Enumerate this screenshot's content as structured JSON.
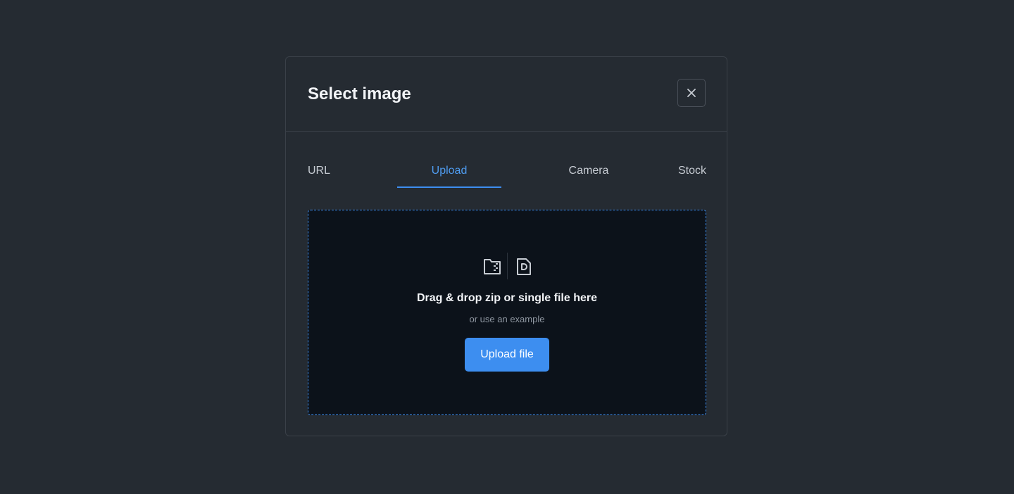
{
  "modal": {
    "title": "Select image",
    "close_icon": "close-icon"
  },
  "tabs": [
    {
      "label": "URL",
      "active": false
    },
    {
      "label": "Upload",
      "active": true
    },
    {
      "label": "Camera",
      "active": false
    },
    {
      "label": "Stock",
      "active": false
    }
  ],
  "dropzone": {
    "icons": [
      "folder-zip-icon",
      "file-icon"
    ],
    "title": "Drag & drop zip or single file here",
    "subtitle": "or use an example",
    "button_label": "Upload file"
  },
  "colors": {
    "background": "#252b32",
    "dropzone_background": "#0c121a",
    "accent": "#3d8ef0",
    "active_tab_text": "#4f9cf0"
  }
}
